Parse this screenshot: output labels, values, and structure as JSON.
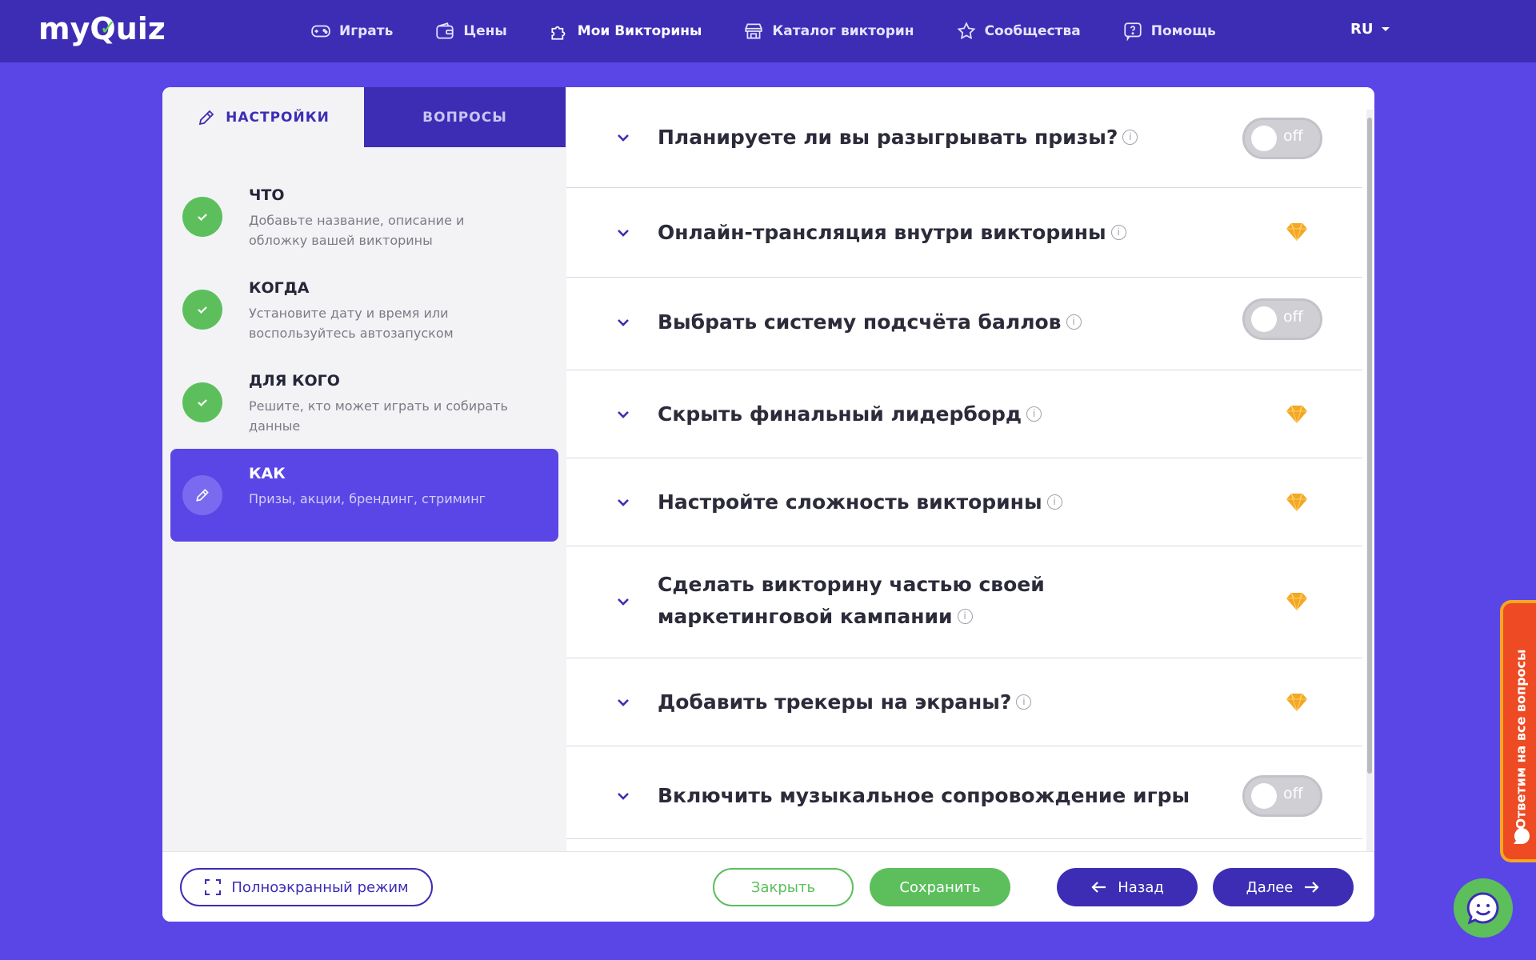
{
  "logo": {
    "text_prefix": "my",
    "text_q": "Q",
    "text_suffix": "uiz"
  },
  "nav": {
    "items": [
      {
        "label": "Играть",
        "icon": "gamepad-icon"
      },
      {
        "label": "Цены",
        "icon": "wallet-icon"
      },
      {
        "label": "Мои Викторины",
        "icon": "puzzle-icon",
        "active": true
      },
      {
        "label": "Каталог викторин",
        "icon": "store-icon"
      },
      {
        "label": "Сообщества",
        "icon": "star-icon"
      },
      {
        "label": "Помощь",
        "icon": "help-icon"
      }
    ],
    "language": "RU"
  },
  "tabs": {
    "settings": "НАСТРОЙКИ",
    "questions": "ВОПРОСЫ"
  },
  "steps": [
    {
      "title": "ЧТО",
      "desc": "Добавьте название, описание и обложку вашей викторины",
      "status": "done"
    },
    {
      "title": "КОГДА",
      "desc": "Установите дату и время или воспользуйтесь автозапуском",
      "status": "done"
    },
    {
      "title": "ДЛЯ КОГО",
      "desc": "Решите, кто может играть и собирать данные",
      "status": "done"
    },
    {
      "title": "КАК",
      "desc": "Призы, акции, брендинг, стриминг",
      "status": "active"
    }
  ],
  "settings": [
    {
      "label": "Планируете ли вы разыгрывать призы?",
      "info": true,
      "control": "toggle",
      "value": "off"
    },
    {
      "label": "Онлайн-трансляция внутри викторины",
      "info": true,
      "control": "premium"
    },
    {
      "label": "Выбрать систему подсчёта баллов",
      "info": true,
      "control": "toggle",
      "value": "off"
    },
    {
      "label": "Скрыть финальный лидерборд",
      "info": true,
      "control": "premium"
    },
    {
      "label": "Настройте сложность викторины",
      "info": true,
      "control": "premium"
    },
    {
      "label": "Сделать викторину частью своей маркетинговой кампании",
      "info": true,
      "control": "premium"
    },
    {
      "label": "Добавить трекеры на экраны?",
      "info": true,
      "control": "premium"
    },
    {
      "label": "Включить музыкальное сопровождение игры",
      "info": false,
      "control": "toggle",
      "value": "off"
    }
  ],
  "info_glyph": "i",
  "bottom": {
    "fullscreen": "Полноэкранный режим",
    "close": "Закрыть",
    "save": "Сохранить",
    "back": "Назад",
    "next": "Далее"
  },
  "feedback_tab": "Ответим на все вопросы",
  "colors": {
    "background": "#5a46e6",
    "topbar": "#3d2db4",
    "accent": "#3d2db4",
    "green": "#5cbf5c",
    "premium_gem": "#f5a623",
    "feedback": "#ee4a23"
  }
}
